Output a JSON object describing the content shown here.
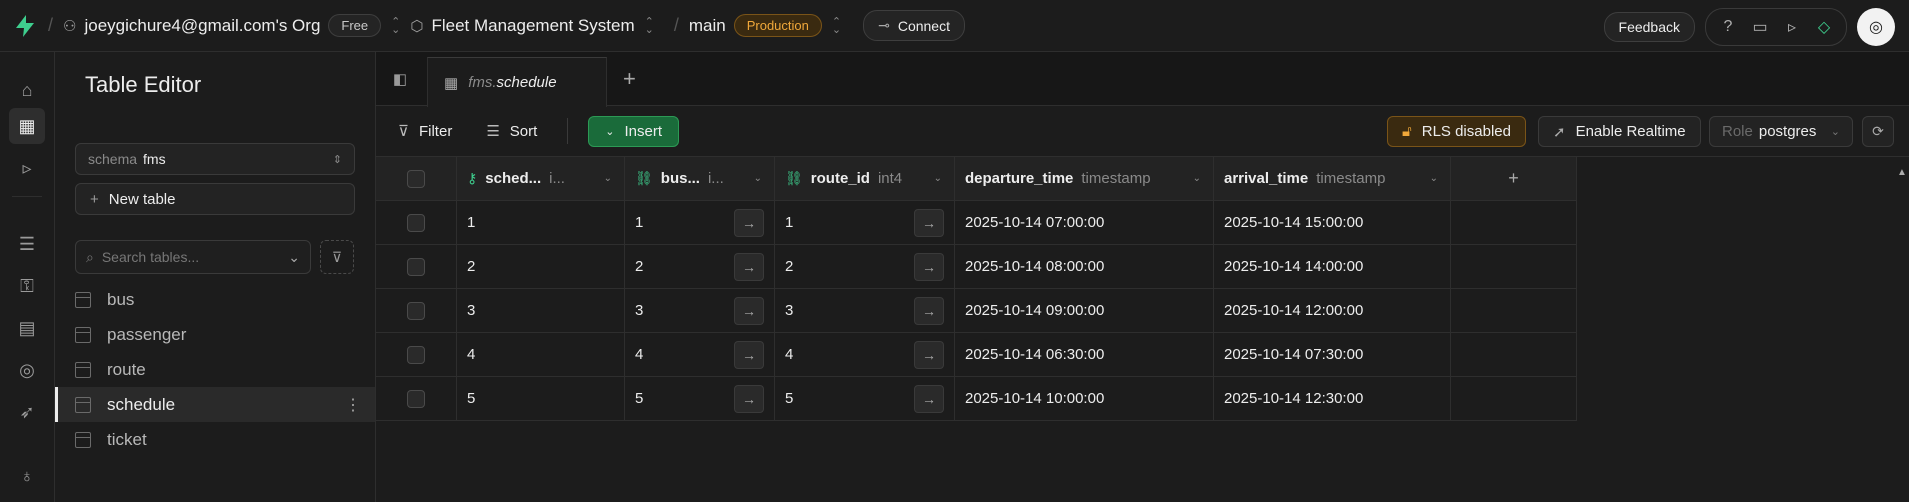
{
  "topbar": {
    "org": "joeygichure4@gmail.com's Org",
    "plan": "Free",
    "project": "Fleet Management System",
    "branch": "main",
    "env": "Production",
    "connect": "Connect",
    "feedback": "Feedback"
  },
  "side": {
    "title": "Table Editor",
    "schema_label": "schema",
    "schema_value": "fms",
    "new_table": "New table",
    "search_placeholder": "Search tables...",
    "tables": [
      "bus",
      "passenger",
      "route",
      "schedule",
      "ticket"
    ],
    "active_table": "schedule"
  },
  "tab": {
    "schema": "fms.",
    "table": "schedule"
  },
  "toolbar": {
    "filter": "Filter",
    "sort": "Sort",
    "insert": "Insert",
    "rls": "RLS disabled",
    "realtime": "Enable Realtime",
    "role_label": "Role",
    "role_value": "postgres"
  },
  "grid": {
    "columns": [
      {
        "name": "sched...",
        "type": "i..."
      },
      {
        "name": "bus...",
        "type": "i..."
      },
      {
        "name": "route_id",
        "type": "int4"
      },
      {
        "name": "departure_time",
        "type": "timestamp"
      },
      {
        "name": "arrival_time",
        "type": "timestamp"
      }
    ],
    "rows": [
      [
        "1",
        "1",
        "1",
        "2025-10-14 07:00:00",
        "2025-10-14 15:00:00"
      ],
      [
        "2",
        "2",
        "2",
        "2025-10-14 08:00:00",
        "2025-10-14 14:00:00"
      ],
      [
        "3",
        "3",
        "3",
        "2025-10-14 09:00:00",
        "2025-10-14 12:00:00"
      ],
      [
        "4",
        "4",
        "4",
        "2025-10-14 06:30:00",
        "2025-10-14 07:30:00"
      ],
      [
        "5",
        "5",
        "5",
        "2025-10-14 10:00:00",
        "2025-10-14 12:30:00"
      ]
    ]
  },
  "colors": {
    "accent": "#3ecf8e",
    "insert_bg": "#1a6b3a",
    "warning": "#f0a83a"
  }
}
